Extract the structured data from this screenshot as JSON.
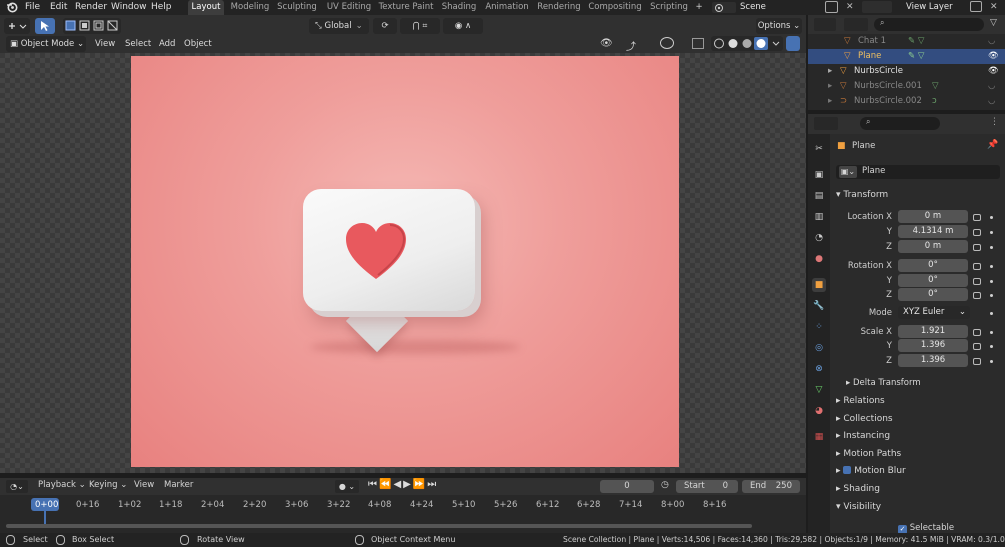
{
  "menubar": {
    "items": [
      "File",
      "Edit",
      "Render",
      "Window",
      "Help"
    ],
    "workspaces": [
      "Layout",
      "Modeling",
      "Sculpting",
      "UV Editing",
      "Texture Paint",
      "Shading",
      "Animation",
      "Rendering",
      "Compositing",
      "Scripting"
    ],
    "add_tab": "+",
    "scene": "Scene",
    "view_layer": "View Layer"
  },
  "viewport_header": {
    "mode": "Object Mode",
    "menus": [
      "View",
      "Select",
      "Add",
      "Object"
    ],
    "orientation": "Global",
    "options": "Options"
  },
  "outliner": {
    "search_placeholder": "",
    "rows": [
      {
        "name": "Chat 1",
        "dim": true
      },
      {
        "name": "Plane",
        "selected": true
      },
      {
        "name": "NurbsCircle",
        "dim": false
      },
      {
        "name": "NurbsCircle.001",
        "dim": true
      },
      {
        "name": "NurbsCircle.002",
        "dim": true
      }
    ]
  },
  "properties": {
    "object_name": "Plane",
    "data_name": "Plane",
    "transform_title": "Transform",
    "location": {
      "label_x": "Location X",
      "label_y": "Y",
      "label_z": "Z",
      "x": "0 m",
      "y": "4.1314 m",
      "z": "0 m"
    },
    "rotation": {
      "label_x": "Rotation X",
      "label_y": "Y",
      "label_z": "Z",
      "x": "0°",
      "y": "0°",
      "z": "0°"
    },
    "mode_label": "Mode",
    "mode_value": "XYZ Euler",
    "scale": {
      "label_x": "Scale X",
      "label_y": "Y",
      "label_z": "Z",
      "x": "1.921",
      "y": "1.396",
      "z": "1.396"
    },
    "delta": "Delta Transform",
    "sections": [
      "Relations",
      "Collections",
      "Instancing",
      "Motion Paths",
      "Motion Blur",
      "Shading",
      "Visibility"
    ],
    "selectable": "Selectable"
  },
  "timeline": {
    "menus": [
      "Playback",
      "Keying",
      "View",
      "Marker"
    ],
    "current_frame": "0",
    "start_label": "Start",
    "start": "0",
    "end_label": "End",
    "end": "250",
    "ticks": [
      "0+00",
      "0+16",
      "1+02",
      "1+18",
      "2+04",
      "2+20",
      "3+06",
      "3+22",
      "4+08",
      "4+24",
      "5+10",
      "5+26",
      "6+12",
      "6+28",
      "7+14",
      "8+00",
      "8+16"
    ]
  },
  "statusbar": {
    "select": "Select",
    "box_select": "Box Select",
    "rotate_view": "Rotate View",
    "context_menu": "Object Context Menu",
    "stats": "Scene Collection | Plane | Verts:14,506 | Faces:14,360 | Tris:29,582 | Objects:1/9 | Memory: 41.5 MiB | VRAM: 0.3/1.0 G"
  },
  "colors": {
    "accent": "#4772b3",
    "render_bg": "#ef9e9b",
    "heart": "#e8595e"
  }
}
